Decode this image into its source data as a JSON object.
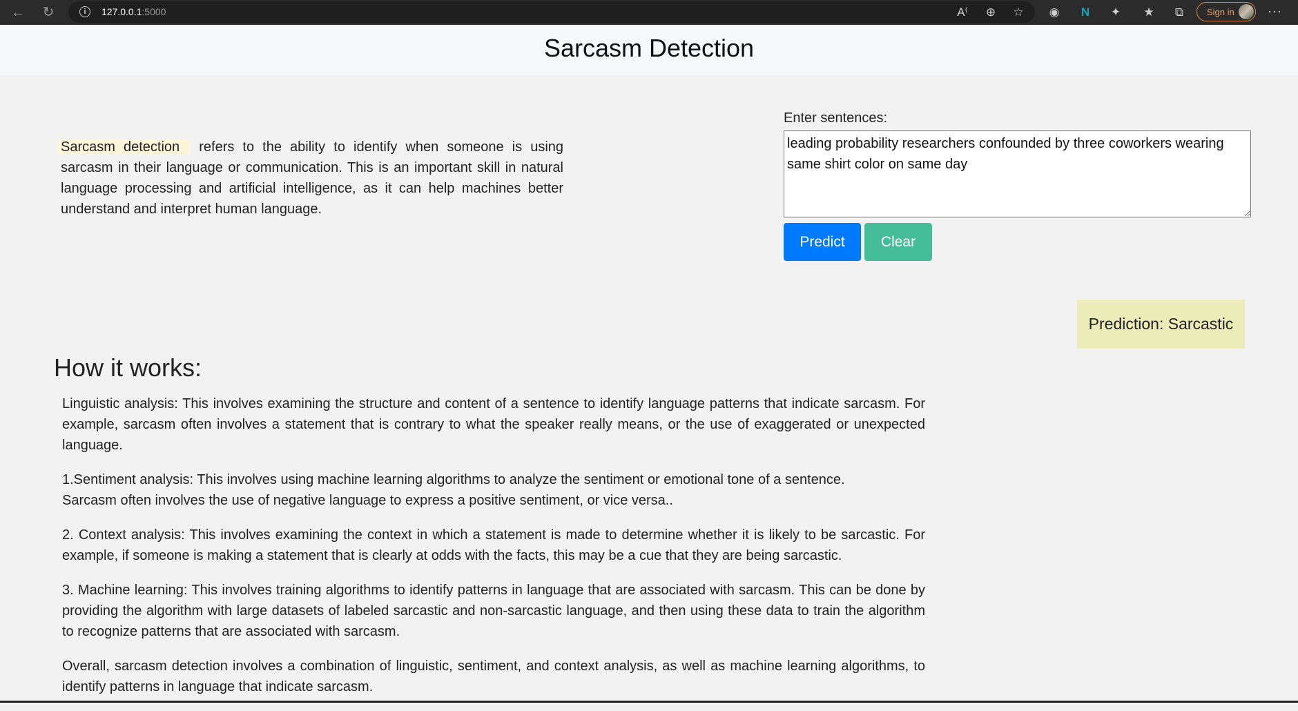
{
  "browser": {
    "url_host": "127.0.0.1",
    "url_port": ":5000",
    "icons": [
      "back-icon",
      "refresh-icon",
      "info-icon",
      "read-aloud-icon",
      "zoom-icon",
      "favorite-icon",
      "extension-icon",
      "n-extension-icon",
      "extensions-icon",
      "favorites-icon",
      "collections-icon",
      "more-icon"
    ],
    "sign_in_label": "Sign in",
    "more_label": "···"
  },
  "header": {
    "title": "Sarcasm Detection"
  },
  "intro": {
    "highlight": "Sarcasm detection",
    "text": "refers to the ability to identify when someone is using sarcasm in their language or communication. This is an important skill in natural language processing and artificial intelligence, as it can help machines better understand and interpret human language."
  },
  "form": {
    "label": "Enter sentences:",
    "input_value": "leading probability researchers confounded by three coworkers wearing same shirt color on same day",
    "predict_label": "Predict",
    "clear_label": "Clear"
  },
  "result": {
    "prediction": "Prediction: Sarcastic"
  },
  "how": {
    "title": "How it works:",
    "steps": [
      "Linguistic analysis: This involves examining the structure and content of a sentence to identify language patterns that indicate sarcasm. For example, sarcasm often involves a statement that is contrary to what the speaker really means, or the use of exaggerated or unexpected language.",
      "1.Sentiment analysis: This involves using machine learning algorithms to analyze the sentiment or emotional tone of a sentence.",
      "Sarcasm often involves the use of negative language to express a positive sentiment, or vice versa..",
      "2. Context analysis: This involves examining the context in which a statement is made to determine whether it is likely to be sarcastic. For example, if someone is making a statement that is clearly at odds with the facts, this may be a cue that they are being sarcastic.",
      "3. Machine learning: This involves training algorithms to identify patterns in language that are associated with sarcasm. This can be done by providing the algorithm with large datasets of labeled sarcastic and non-sarcastic language, and then using these data to train the algorithm to recognize patterns that are associated with sarcasm.",
      "Overall, sarcasm detection involves a combination of linguistic, sentiment, and context analysis, as well as machine learning algorithms, to identify patterns in language that indicate sarcasm."
    ]
  },
  "colors": {
    "predict": "#007bff",
    "clear": "#45bd98",
    "prediction_bg": "#ececb8",
    "highlight_bg": "#fdf5d9"
  }
}
